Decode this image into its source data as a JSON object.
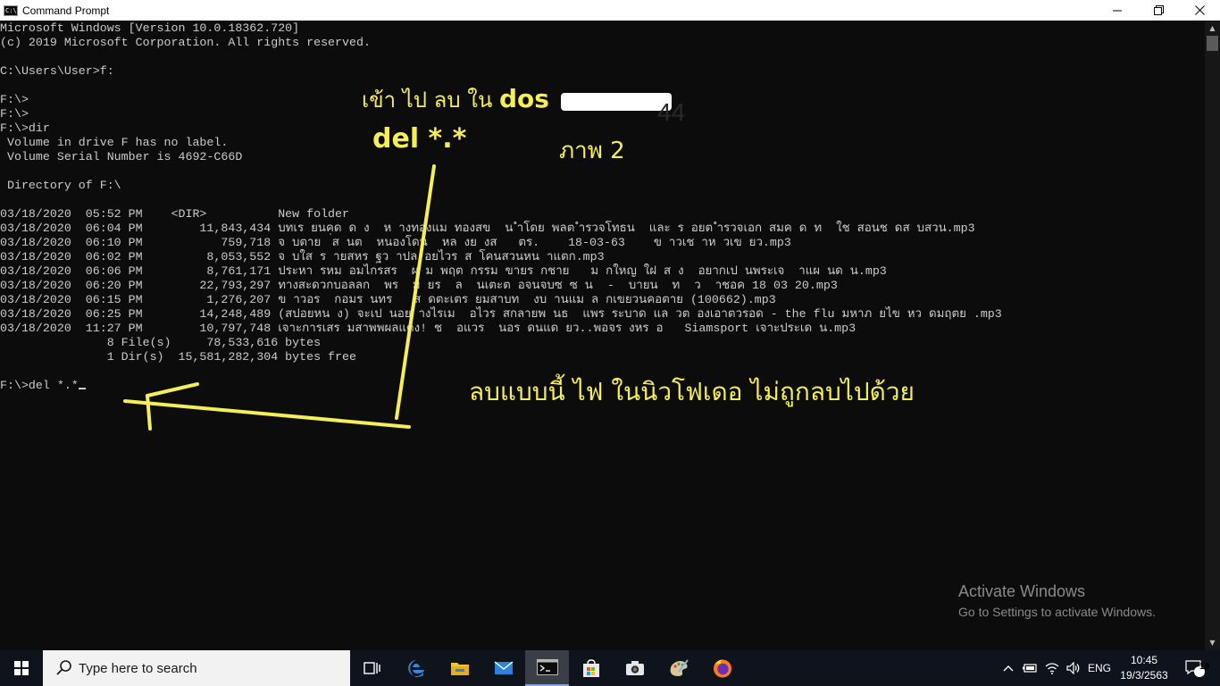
{
  "window": {
    "title": "Command Prompt",
    "controls": {
      "minimize": "—",
      "maximize": "❐",
      "close": "✕"
    }
  },
  "console": {
    "lines": [
      "Microsoft Windows [Version 10.0.18362.720]",
      "(c) 2019 Microsoft Corporation. All rights reserved.",
      "",
      "C:\\Users\\User>f:",
      "",
      "F:\\>",
      "F:\\>",
      "F:\\>dir",
      " Volume in drive F has no label.",
      " Volume Serial Number is 4692-C66D",
      "",
      " Directory of F:\\",
      "",
      "03/18/2020  05:52 PM    <DIR>          New folder",
      "03/18/2020  06:04 PM        11,843,434 บทเร ยนคด ด ง  ห างทองแม ทองสข  น ำโดย พลต ำรวจโทธน  และ ร อยต ำรวจเอก สมค ด ท  ใช สอนช ดส บสวน.mp3",
      "03/18/2020  06:10 PM           759,718 จ บตาย  ่ส นต  หนองโดน  หล งย งส   ตร.    18-03-63    ข าวเช าห วเข ยว.mp3",
      "03/18/2020  06:02 PM         8,053,552 จ บใส ร ายสหร ฐว าปล อยไวร ส โคนสวนหน าแตก.mp3",
      "03/18/2020  06:06 PM         8,761,171 ประหา รหม อมไกรสร  ผ ม พฤต กรรม ขายร กชาย   ม กใหญ ใฝ ส ง  อยากเป นพระเจ  าแผ นด น.mp3",
      "03/18/2020  06:20 PM        22,793,297 ทางสะดวกบอลลก  พร  ม ยร  ล  นเตะต อจนจบซ ซ น  -  บายน  ท  ว  าชอค 18 03 20.mp3",
      "03/18/2020  06:15 PM         1,276,207 ข าวอร  กอมร นทร   ส ดตะเตร ยมสาบท  งบ านแม ล กเขยวนคอตาย (100662).mp3",
      "03/18/2020  06:25 PM        14,248,489 (สปอยหน ง) จะเป นอย างไรเม  อไวร สกลายพ นธ  แพร ระบาด แล วต องเอาตวรอด - the flu มหาภ ยไข หว ดมฤตย .mp3",
      "03/18/2020  11:27 PM        10,797,748 เจาะการเสร มสาพพผลแดง! ช  อแวร  นอร ดนแด ยว..พอจร งหร อ   Siamsport เจาะประเด น.mp3",
      "               8 File(s)     78,533,616 bytes",
      "               1 Dir(s)  15,581,282,304 bytes free",
      "",
      "F:\\>del *.*"
    ]
  },
  "annotations": {
    "note_top_thai": "เข้า ไป ลบ ใน",
    "note_top_dos": "dos",
    "note_command": "del *.*",
    "note_partial": "44",
    "note_picture": "ภาพ 2",
    "note_bottom": "ลบแบบนี้ ไฟ ในนิวโฟเดอ ไม่ถูกลบไปด้วย"
  },
  "watermark": {
    "line1": "Activate Windows",
    "line2": "Go to Settings to activate Windows."
  },
  "taskbar": {
    "search_placeholder": "Type here to search",
    "tray": {
      "chevron": "^",
      "lang": "ENG"
    },
    "clock": {
      "time": "10:45",
      "date": "19/3/2563"
    },
    "notifications_count": "19"
  },
  "colors": {
    "console_bg": "#0c0c0c",
    "console_text": "#cccccc",
    "annotation": "#f5ee57",
    "taskbar_bg": "#0f141c"
  }
}
